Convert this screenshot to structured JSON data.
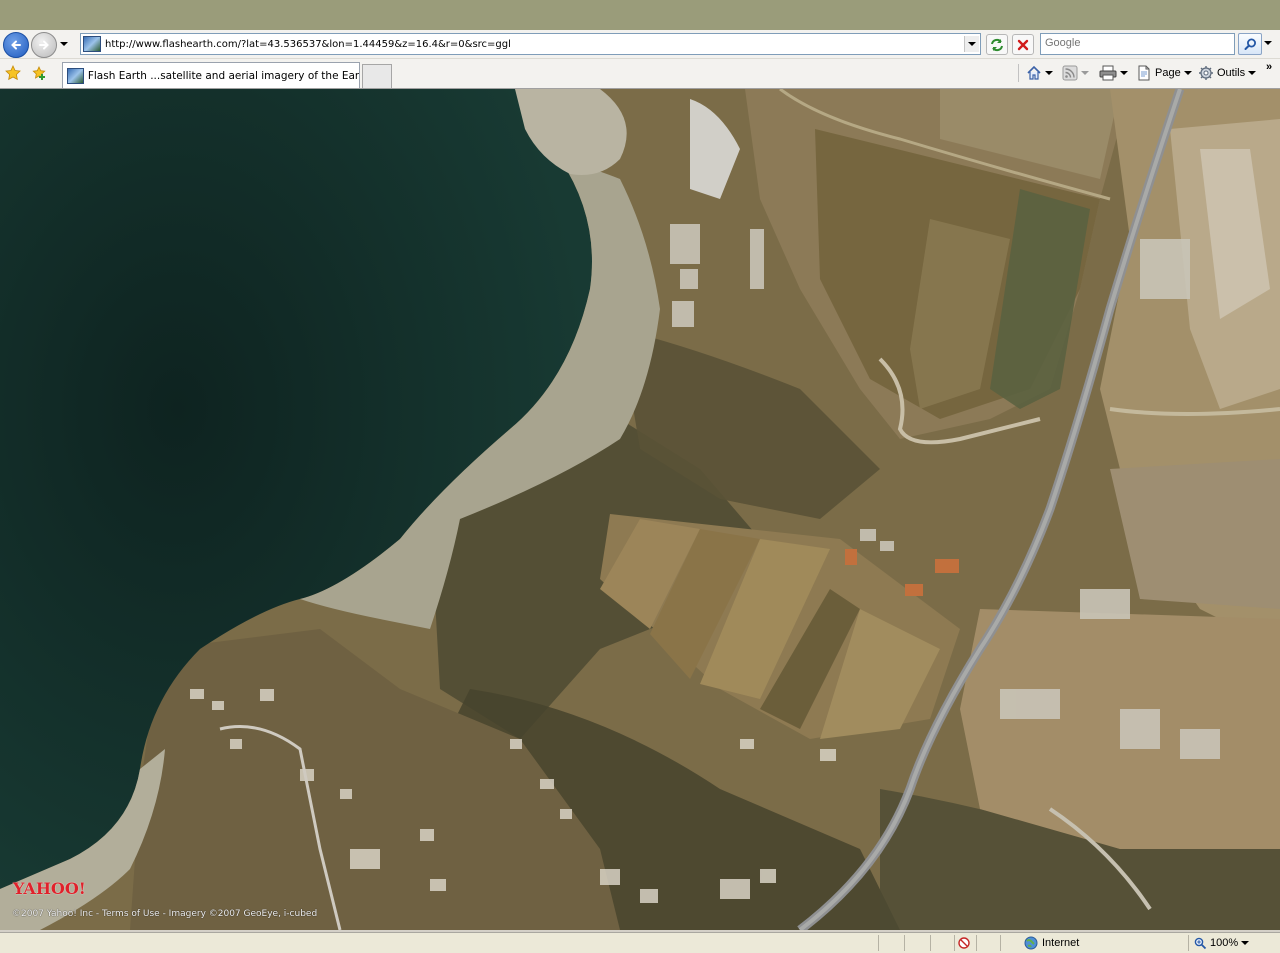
{
  "browser": {
    "address_url": "http://www.flashearth.com/?lat=43.536537&lon=1.44459&z=16.4&r=0&src=ggl",
    "search_placeholder": "Google",
    "tab_title": "Flash Earth ...satellite and aerial imagery of the Earth...",
    "commands": {
      "page_label": "Page",
      "tools_label": "Outils",
      "overflow": "»"
    },
    "icons": {
      "back": "back-arrow-icon",
      "forward": "forward-arrow-icon",
      "refresh": "refresh-icon",
      "stop": "stop-icon",
      "search": "search-icon",
      "favorites": "favorites-star-icon",
      "add_favorites": "add-favorites-icon",
      "home": "home-icon",
      "feeds": "rss-feed-icon",
      "print": "printer-icon",
      "page": "page-icon",
      "tools": "gear-icon"
    }
  },
  "map": {
    "logo_text": "YAHOO!",
    "attribution": "©2007 Yahoo! Inc - Terms of Use - Imagery ©2007 GeoEye, i-cubed"
  },
  "status_bar": {
    "zone_label": "Internet",
    "zoom_label": "100%"
  },
  "colors": {
    "sea": "#0f2a26",
    "beach": "#a8a48f",
    "land": "#7b6c48",
    "road": "#9a9a98",
    "yahoo_red": "#e0212b"
  }
}
